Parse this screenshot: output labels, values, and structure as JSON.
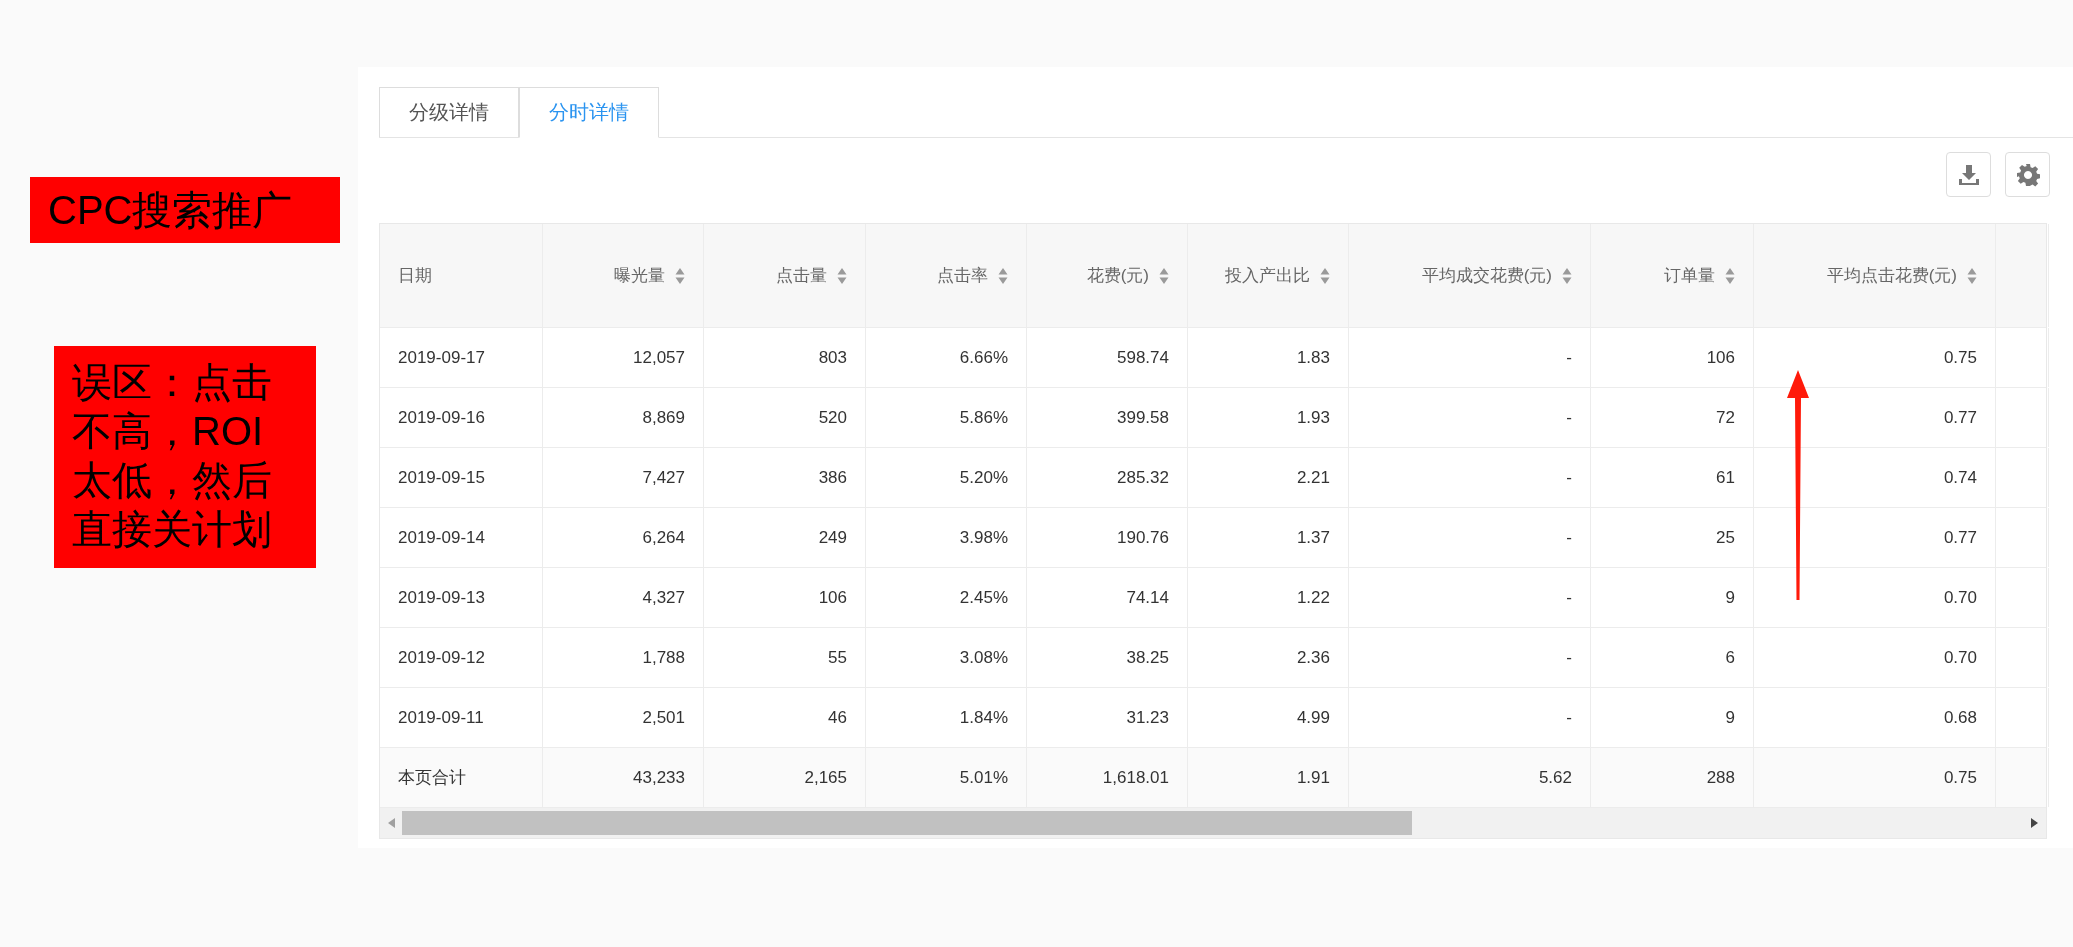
{
  "annotations": {
    "title_tag": "CPC搜索推广",
    "note": "误区：点击不高，ROI太低，然后直接关计划"
  },
  "tabs": [
    {
      "label": "分级详情",
      "selected": false
    },
    {
      "label": "分时详情",
      "selected": true
    }
  ],
  "table": {
    "columns": [
      {
        "label": "日期",
        "sortable": false,
        "kind": "date"
      },
      {
        "label": "曝光量",
        "sortable": true,
        "kind": "number"
      },
      {
        "label": "点击量",
        "sortable": true,
        "kind": "number"
      },
      {
        "label": "点击率",
        "sortable": true,
        "kind": "number"
      },
      {
        "label": "花费(元)",
        "sortable": true,
        "kind": "number"
      },
      {
        "label": "投入产出比",
        "sortable": true,
        "kind": "number"
      },
      {
        "label": "平均成交花费(元)",
        "sortable": true,
        "kind": "number"
      },
      {
        "label": "订单量",
        "sortable": true,
        "kind": "number"
      },
      {
        "label": "平均点击花费(元)",
        "sortable": true,
        "kind": "number"
      }
    ],
    "rows": [
      [
        "2019-09-17",
        "12,057",
        "803",
        "6.66%",
        "598.74",
        "1.83",
        "-",
        "106",
        "0.75"
      ],
      [
        "2019-09-16",
        "8,869",
        "520",
        "5.86%",
        "399.58",
        "1.93",
        "-",
        "72",
        "0.77"
      ],
      [
        "2019-09-15",
        "7,427",
        "386",
        "5.20%",
        "285.32",
        "2.21",
        "-",
        "61",
        "0.74"
      ],
      [
        "2019-09-14",
        "6,264",
        "249",
        "3.98%",
        "190.76",
        "1.37",
        "-",
        "25",
        "0.77"
      ],
      [
        "2019-09-13",
        "4,327",
        "106",
        "2.45%",
        "74.14",
        "1.22",
        "-",
        "9",
        "0.70"
      ],
      [
        "2019-09-12",
        "1,788",
        "55",
        "3.08%",
        "38.25",
        "2.36",
        "-",
        "6",
        "0.70"
      ],
      [
        "2019-09-11",
        "2,501",
        "46",
        "1.84%",
        "31.23",
        "4.99",
        "-",
        "9",
        "0.68"
      ]
    ],
    "summary": [
      "本页合计",
      "43,233",
      "2,165",
      "5.01%",
      "1,618.01",
      "1.91",
      "5.62",
      "288",
      "0.75"
    ]
  }
}
